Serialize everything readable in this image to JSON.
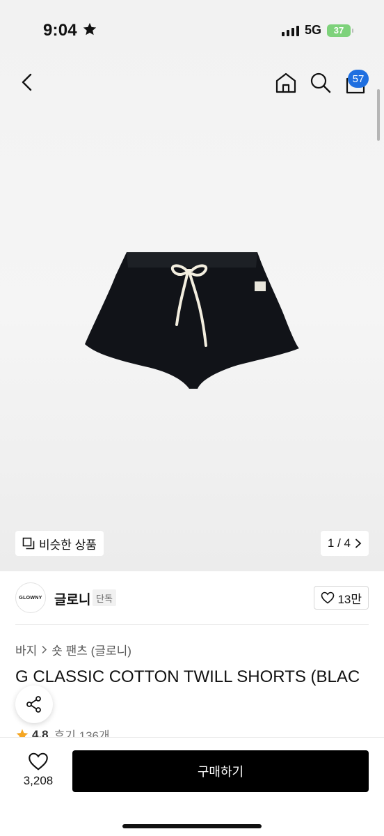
{
  "status_bar": {
    "time": "9:04",
    "network": "5G",
    "battery": "37"
  },
  "nav": {
    "cart_count": "57",
    "icons": [
      "chevron-left-icon",
      "home-icon",
      "search-icon",
      "shopping-bag-icon"
    ]
  },
  "gallery": {
    "similar_label": "비슷한 상품",
    "page_indicator": "1 / 4"
  },
  "brand": {
    "logo_text": "GLOWNY",
    "name": "글로니",
    "tag": "단독",
    "likes": "13만"
  },
  "breadcrumb": {
    "category": "바지",
    "subcategory": "숏 팬츠 (글로니)"
  },
  "product": {
    "title": "G CLASSIC COTTON TWILL SHORTS (BLAC",
    "rating": "4.8",
    "review_label": "후기 136개"
  },
  "bottom": {
    "wish_count": "3,208",
    "buy_label": "구매하기"
  },
  "colors": {
    "accent_badge": "#1f6fe0",
    "rating_star": "#f5a623",
    "buy_button": "#000000"
  }
}
